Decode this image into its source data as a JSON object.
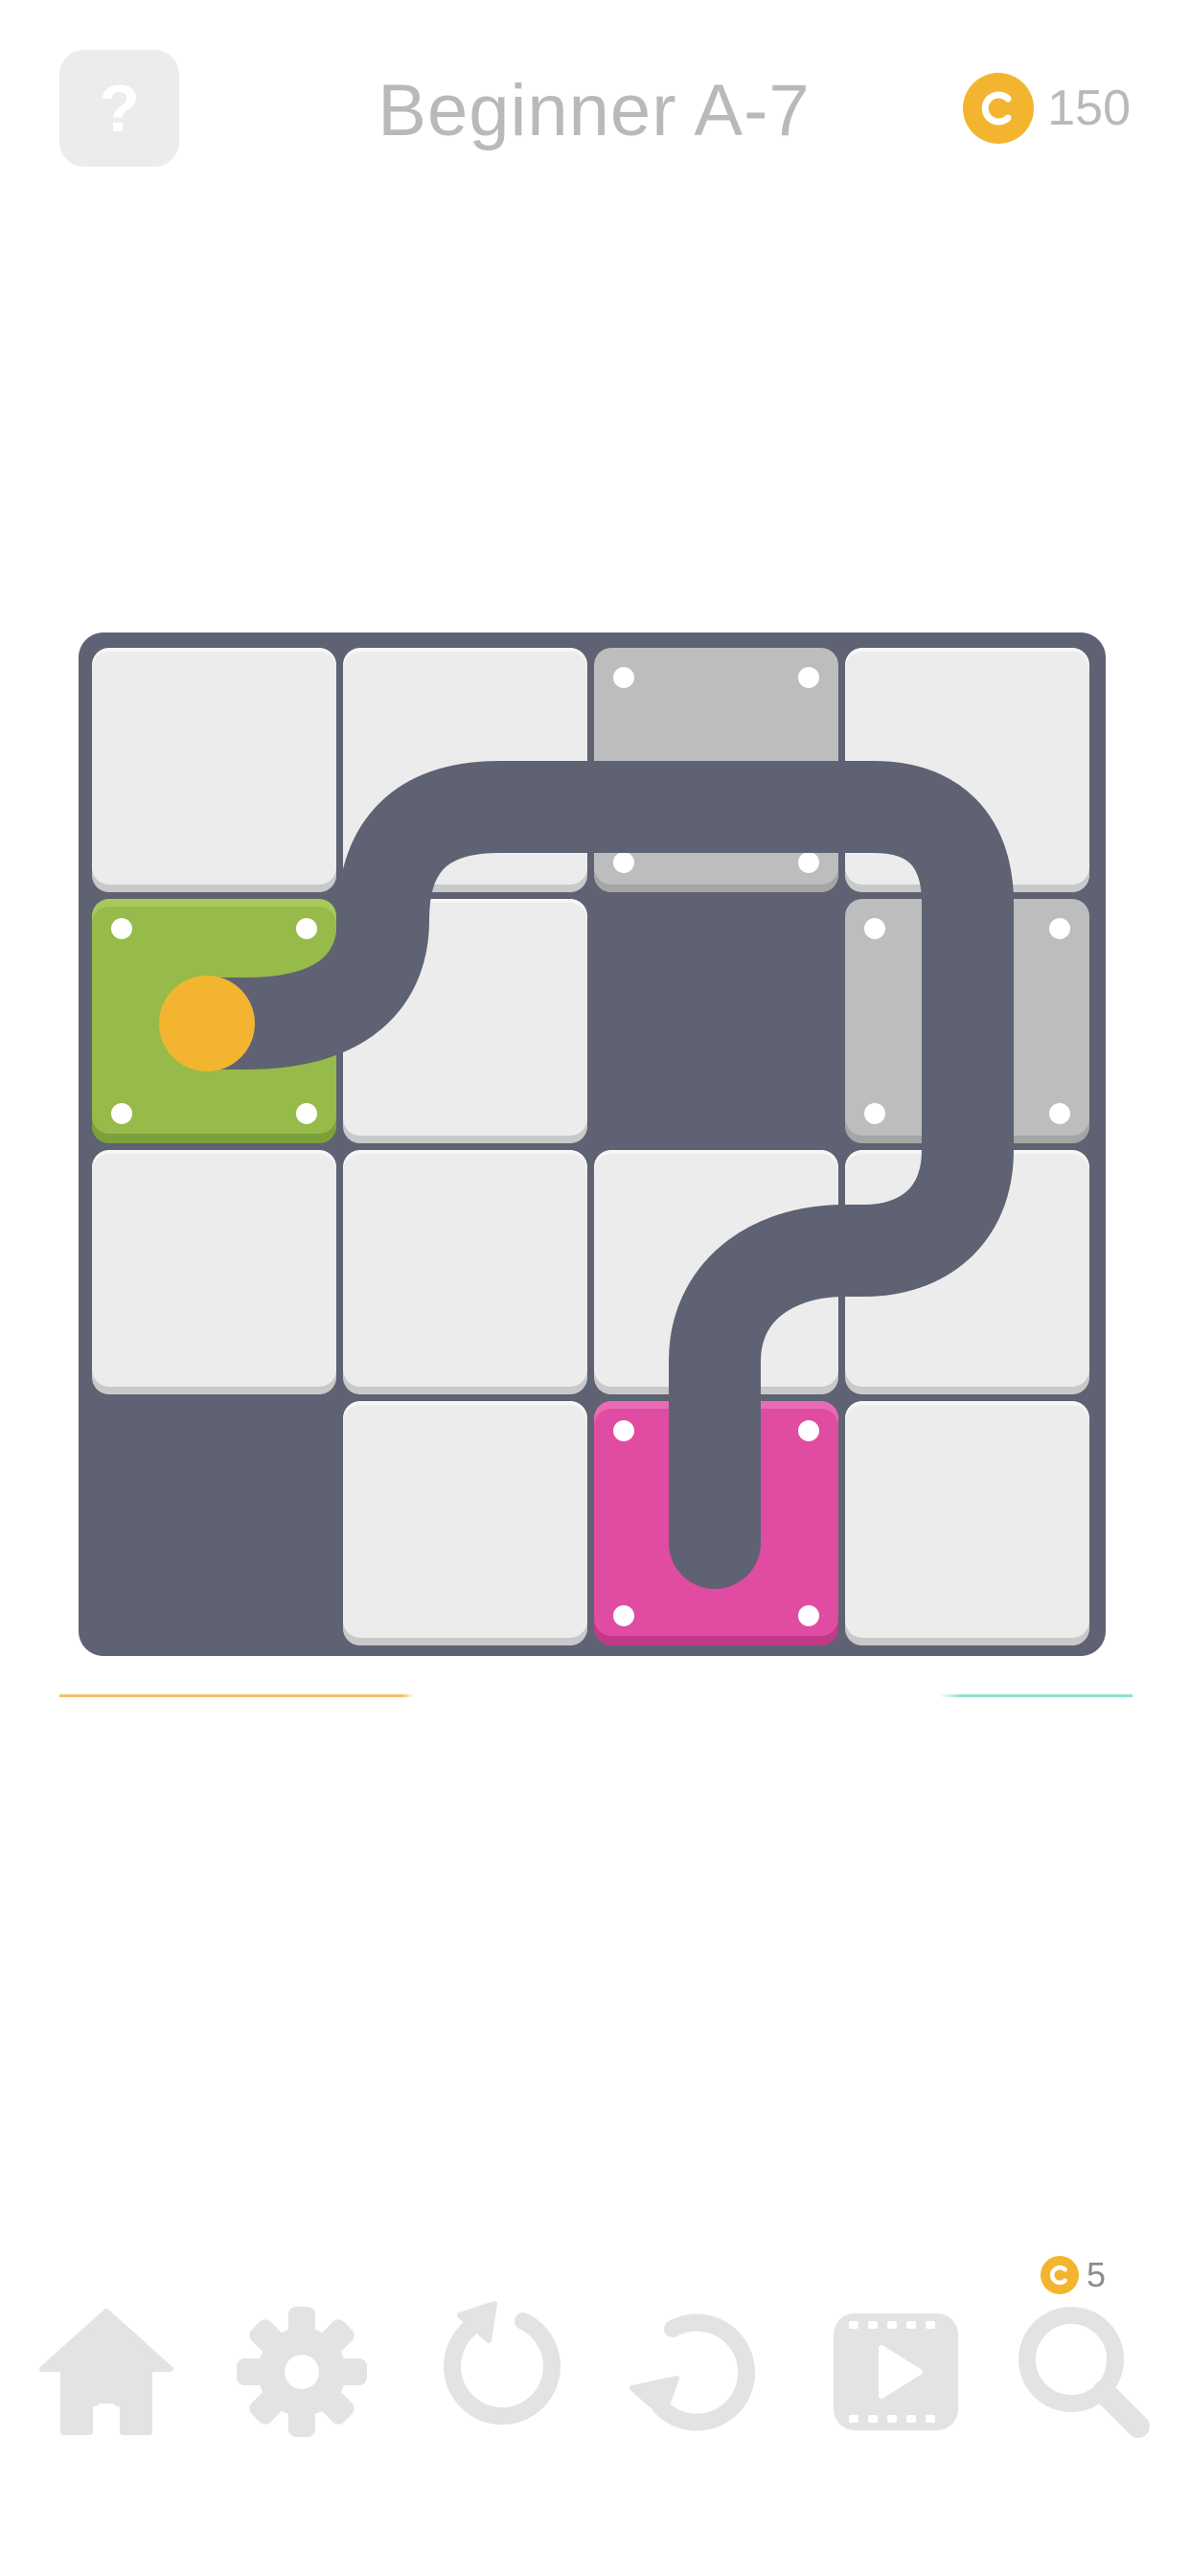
{
  "header": {
    "help_label": "?",
    "level_title": "Beginner A-7",
    "coins": "150",
    "coin_icon": "coin-icon"
  },
  "board": {
    "rows": 4,
    "cols": 4,
    "tiles": [
      [
        "empty",
        "empty",
        "fixed-horizontal",
        "empty"
      ],
      [
        "start",
        "empty",
        "hole",
        "fixed-vertical"
      ],
      [
        "empty",
        "empty",
        "empty",
        "empty"
      ],
      [
        "hole",
        "empty",
        "end",
        "empty"
      ]
    ],
    "start_color": "#96bb4a",
    "end_color": "#df4ca2",
    "ball_color": "#f3b52f",
    "path_color": "#5e6272"
  },
  "toolbar": {
    "hint_cost": "5",
    "buttons": [
      "home-icon",
      "settings-icon",
      "restart-icon",
      "undo-icon",
      "video-icon",
      "hint-search-icon"
    ]
  }
}
